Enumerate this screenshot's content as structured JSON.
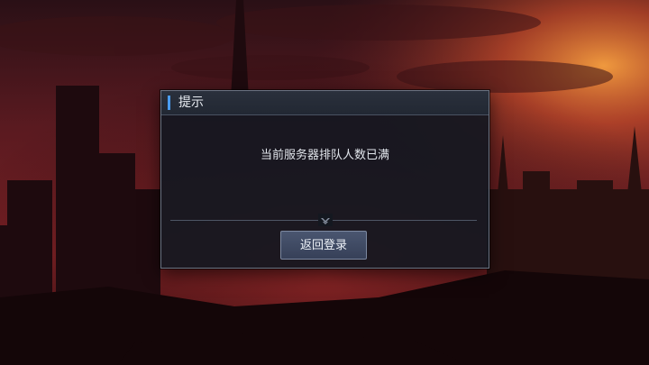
{
  "dialog": {
    "title": "提示",
    "message": "当前服务器排队人数已满",
    "button_label": "返回登录"
  },
  "colors": {
    "header_accent": "#4a9cf0",
    "sky_red": "#8a1f24",
    "sun_orange": "#f07a30"
  },
  "icons": {
    "divider_ornament": "chevron-down-icon"
  }
}
